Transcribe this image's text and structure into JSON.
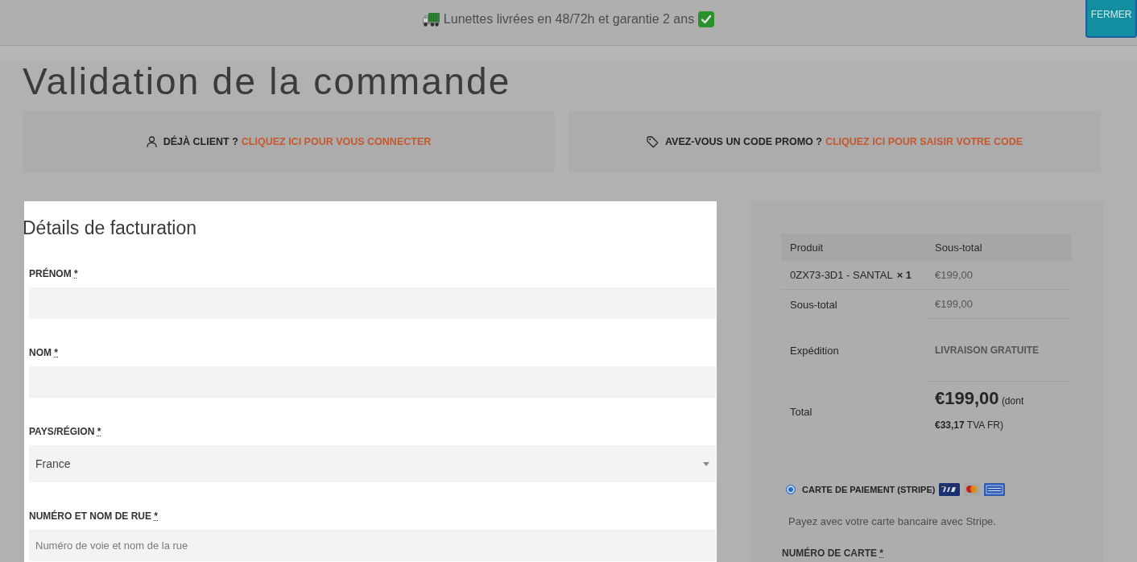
{
  "announcement": {
    "text": "Lunettes livrées en 48/72h et garantie 2 ans",
    "close_button": "FERMER"
  },
  "page_title": "Validation de la commande",
  "notices": [
    {
      "kind": "login",
      "prompt": "DÉJÀ CLIENT ?",
      "link": "CLIQUEZ ICI POUR VOUS CONNECTER"
    },
    {
      "kind": "coupon",
      "prompt": "AVEZ-VOUS UN CODE PROMO ?",
      "link": "CLIQUEZ ICI POUR SAISIR VOTRE CODE"
    }
  ],
  "billing": {
    "title": "Détails de facturation",
    "fields": [
      {
        "kind": "text",
        "label": "PRÉNOM",
        "required_mark": "*"
      },
      {
        "kind": "text",
        "label": "NOM",
        "required_mark": "*"
      },
      {
        "kind": "select",
        "label": "PAYS/RÉGION",
        "required_mark": "*",
        "value": "France"
      },
      {
        "kind": "text",
        "label": "NUMÉRO ET NOM DE RUE",
        "required_mark": "*",
        "placeholder": "Numéro de voie et nom de la rue"
      }
    ]
  },
  "order_review": {
    "columns": [
      "Produit",
      "Sous-total"
    ],
    "items": [
      {
        "name": "0ZX73-3D1 - SANTAL",
        "quantity": "× 1",
        "subtotal": "€199,00"
      }
    ],
    "subtotal": {
      "label": "Sous-total",
      "value": "€199,00"
    },
    "shipping": {
      "label": "Expédition",
      "value": "LIVRAISON GRATUITE"
    },
    "total": {
      "label": "Total",
      "amount": "€199,00",
      "tax_note": "(dont **€33,17** TVA FR)"
    }
  },
  "payment": {
    "methods": [
      {
        "label": "CARTE DE PAIEMENT (STRIPE)",
        "selected": true,
        "description": "Payez avec votre carte bancaire avec Stripe."
      }
    ],
    "card_number": {
      "label": "NUMÉRO DE CARTE",
      "required_mark": "*"
    }
  }
}
